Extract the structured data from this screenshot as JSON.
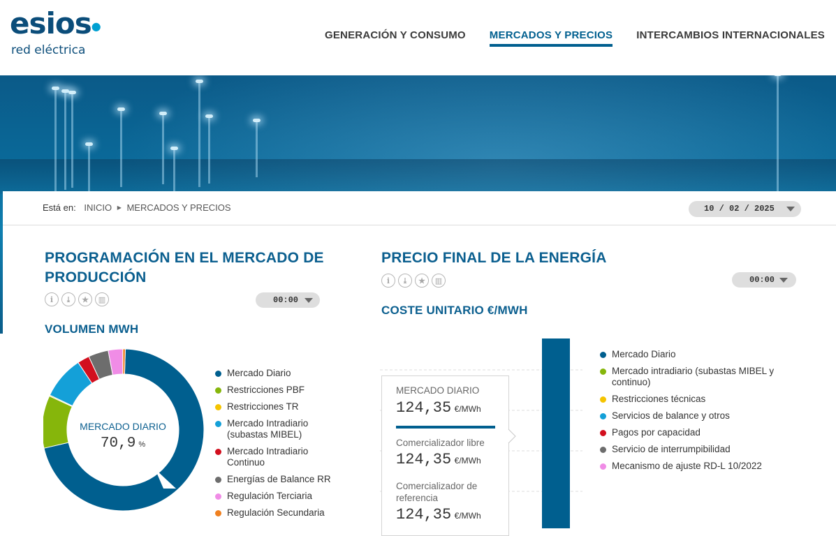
{
  "brand": {
    "name": "esios",
    "subtitle": "red eléctrica"
  },
  "nav": [
    {
      "label": "GENERACIÓN Y CONSUMO",
      "active": false
    },
    {
      "label": "MERCADOS Y PRECIOS",
      "active": true
    },
    {
      "label": "INTERCAMBIOS INTERNACIONALES",
      "active": false
    }
  ],
  "breadcrumb": {
    "prefix": "Está en:",
    "home": "INICIO",
    "current": "MERCADOS Y PRECIOS"
  },
  "date_selector": {
    "value": "10 / 02 / 2025"
  },
  "left_section": {
    "title": "PROGRAMACIÓN EN EL MERCADO DE PRODUCCIÓN",
    "time": "00:00",
    "subtitle": "VOLUMEN MWH",
    "icons": [
      "info-icon",
      "download-icon",
      "star-icon",
      "chart-icon"
    ],
    "donut_center": {
      "label": "MERCADO DIARIO",
      "value": "70,9",
      "unit": "%"
    },
    "legend": [
      {
        "label": "Mercado Diario",
        "color": "#005f8f"
      },
      {
        "label": "Restricciones PBF",
        "color": "#86b60b"
      },
      {
        "label": "Restricciones TR",
        "color": "#f5c400"
      },
      {
        "label": "Mercado Intradiario (subastas MIBEL)",
        "color": "#14a0d8"
      },
      {
        "label": "Mercado Intradiario Continuo",
        "color": "#d20f1e"
      },
      {
        "label": "Energías de Balance RR",
        "color": "#6d6d6d"
      },
      {
        "label": "Regulación Terciaria",
        "color": "#f08ce6"
      },
      {
        "label": "Regulación Secundaria",
        "color": "#f08020"
      }
    ]
  },
  "chart_data": {
    "type": "pie",
    "categories": [
      "Mercado Diario",
      "Restricciones PBF",
      "Restricciones TR",
      "Mercado Intradiario (subastas MIBEL)",
      "Mercado Intradiario Continuo",
      "Energías de Balance RR",
      "Regulación Terciaria",
      "Regulación Secundaria"
    ],
    "values": [
      70.9,
      10.5,
      0.2,
      8.6,
      2.4,
      4.0,
      2.9,
      0.5
    ],
    "colors": [
      "#005f8f",
      "#86b60b",
      "#f5c400",
      "#14a0d8",
      "#d20f1e",
      "#6d6d6d",
      "#f08ce6",
      "#f08020"
    ],
    "donut": true
  },
  "right_section": {
    "title": "PRECIO FINAL DE LA ENERGÍA",
    "time": "00:00",
    "subtitle": "COSTE UNITARIO €/MWH",
    "icons": [
      "info-icon",
      "download-icon",
      "star-icon",
      "chart-icon"
    ],
    "card": {
      "market_label": "MERCADO DIARIO",
      "market_value": "124,35",
      "unit": "€/MWh",
      "libre_label": "Comercializador libre",
      "libre_value": "124,35",
      "ref_label": "Comercializador de referencia",
      "ref_value": "124,35"
    },
    "legend": [
      {
        "label": "Mercado Diario",
        "color": "#005f8f"
      },
      {
        "label": "Mercado intradiario (subastas MIBEL y continuo)",
        "color": "#86b60b"
      },
      {
        "label": "Restricciones técnicas",
        "color": "#f5c400"
      },
      {
        "label": "Servicios de balance y otros",
        "color": "#14a0d8"
      },
      {
        "label": "Pagos por capacidad",
        "color": "#d20f1e"
      },
      {
        "label": "Servicio de interrumpibilidad",
        "color": "#6d6d6d"
      },
      {
        "label": "Mecanismo de ajuste RD-L 10/2022",
        "color": "#f08ce6"
      }
    ]
  }
}
